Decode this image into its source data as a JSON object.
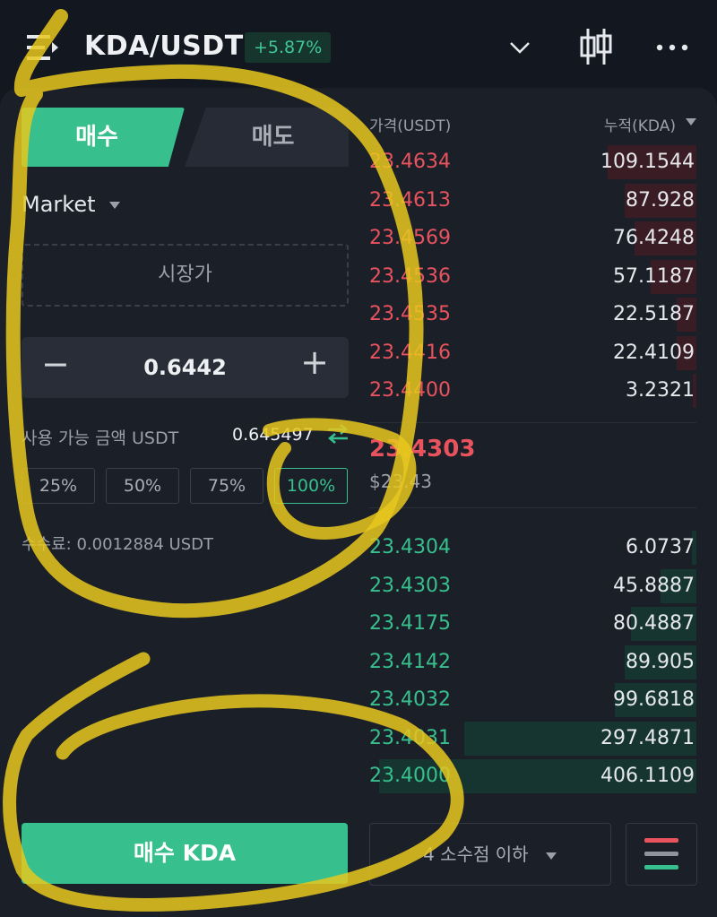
{
  "header": {
    "pair": "KDA/USDT",
    "change": "+5.87%",
    "icons": [
      "menu-icon",
      "chevron-down-icon",
      "candlestick-chart-icon",
      "more-icon"
    ]
  },
  "trade": {
    "tab_buy": "매수",
    "tab_sell": "매도",
    "order_type": "Market",
    "price_placeholder": "시장가",
    "quantity": "0.6442",
    "qty_minus": "−",
    "qty_plus": "+",
    "available_label": "사용 가능 금액 USDT",
    "available_value": "0.645497",
    "percent_options": [
      "25%",
      "50%",
      "75%",
      "100%"
    ],
    "selected_percent": "100%",
    "fee_text": "수수료: 0.0012884 USDT",
    "buy_button": "매수 KDA"
  },
  "orderbook": {
    "price_header": "가격(USDT)",
    "qty_header": "누적(KDA)",
    "asks": [
      {
        "price": "23.4634",
        "qty": "109.1544",
        "depth": 0.27
      },
      {
        "price": "23.4613",
        "qty": "87.928",
        "depth": 0.22
      },
      {
        "price": "23.4569",
        "qty": "76.4248",
        "depth": 0.19
      },
      {
        "price": "23.4536",
        "qty": "57.1187",
        "depth": 0.14
      },
      {
        "price": "23.4535",
        "qty": "22.5187",
        "depth": 0.06
      },
      {
        "price": "23.4416",
        "qty": "22.4109",
        "depth": 0.06
      },
      {
        "price": "23.4400",
        "qty": "3.2321",
        "depth": 0.01
      }
    ],
    "last_price": "23.4303",
    "last_price_usd": "$23.43",
    "bids": [
      {
        "price": "23.4304",
        "qty": "6.0737",
        "depth": 0.015
      },
      {
        "price": "23.4303",
        "qty": "45.8887",
        "depth": 0.11
      },
      {
        "price": "23.4175",
        "qty": "80.4887",
        "depth": 0.2
      },
      {
        "price": "23.4142",
        "qty": "89.905",
        "depth": 0.22
      },
      {
        "price": "23.4032",
        "qty": "99.6818",
        "depth": 0.25
      },
      {
        "price": "23.4031",
        "qty": "297.4871",
        "depth": 0.71
      },
      {
        "price": "23.4000",
        "qty": "406.1109",
        "depth": 0.97
      }
    ],
    "decimals_label": "4 소수점 이하"
  },
  "colors": {
    "buy": "#37c08d",
    "sell": "#e8535e",
    "marker": "#e8c81e"
  }
}
